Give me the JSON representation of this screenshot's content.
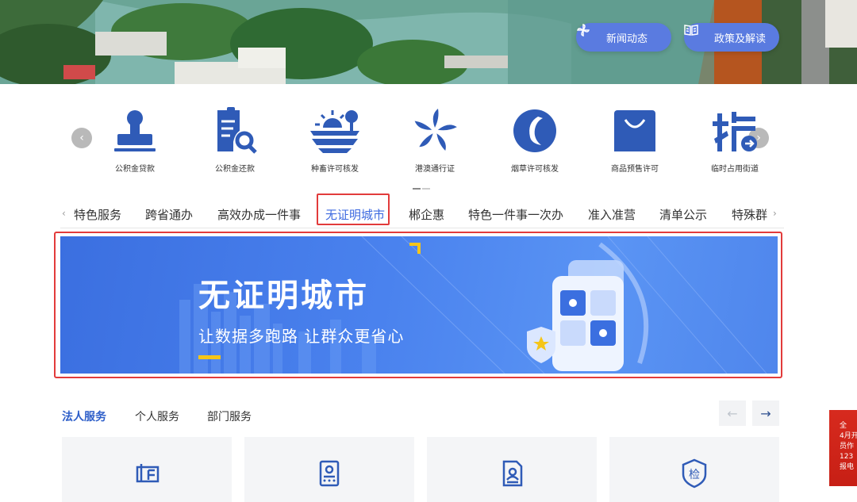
{
  "hero": {
    "news_label": "新闻动态",
    "policy_label": "政策及解读"
  },
  "carousel": {
    "items": [
      {
        "label": "公积金贷款",
        "icon": "stamp-icon"
      },
      {
        "label": "公积金还款",
        "icon": "document-search-icon"
      },
      {
        "label": "种畜许可核发",
        "icon": "farmland-sunrise-icon"
      },
      {
        "label": "港澳通行证",
        "icon": "bauhinia-icon"
      },
      {
        "label": "烟草许可核发",
        "icon": "tobacco-leaf-icon"
      },
      {
        "label": "商品预售许可",
        "icon": "shopping-bag-icon"
      },
      {
        "label": "临时占用街道",
        "icon": "road-occupation-icon"
      }
    ],
    "prev_glyph": "‹",
    "next_glyph": "›"
  },
  "tabs": {
    "items": [
      "特色服务",
      "跨省通办",
      "高效办成一件事",
      "无证明城市",
      "郴企惠",
      "特色一件事一次办",
      "准入准营",
      "清单公示",
      "特殊群"
    ],
    "active_index": 3,
    "prev_glyph": "‹",
    "next_glyph": "›"
  },
  "banner": {
    "title": "无证明城市",
    "subtitle": "让数据多跑路  让群众更省心"
  },
  "services": {
    "tabs": [
      "法人服务",
      "个人服务",
      "部门服务"
    ],
    "active_index": 0,
    "prev_glyph": "←",
    "next_glyph": "→",
    "cards": [
      {
        "icon": "business-license-icon"
      },
      {
        "icon": "id-certificate-icon"
      },
      {
        "icon": "personnel-document-icon"
      },
      {
        "icon": "inspection-shield-icon"
      }
    ]
  },
  "notice": {
    "lines": [
      "全",
      "4月开",
      "员作",
      "123",
      "报电"
    ]
  },
  "colors": {
    "accent": "#3d6ae0",
    "icon_blue": "#2f5bb7",
    "highlight_red": "#e23b3b",
    "banner_blue": "#4a82ee",
    "hero_button": "#5a7be0"
  }
}
